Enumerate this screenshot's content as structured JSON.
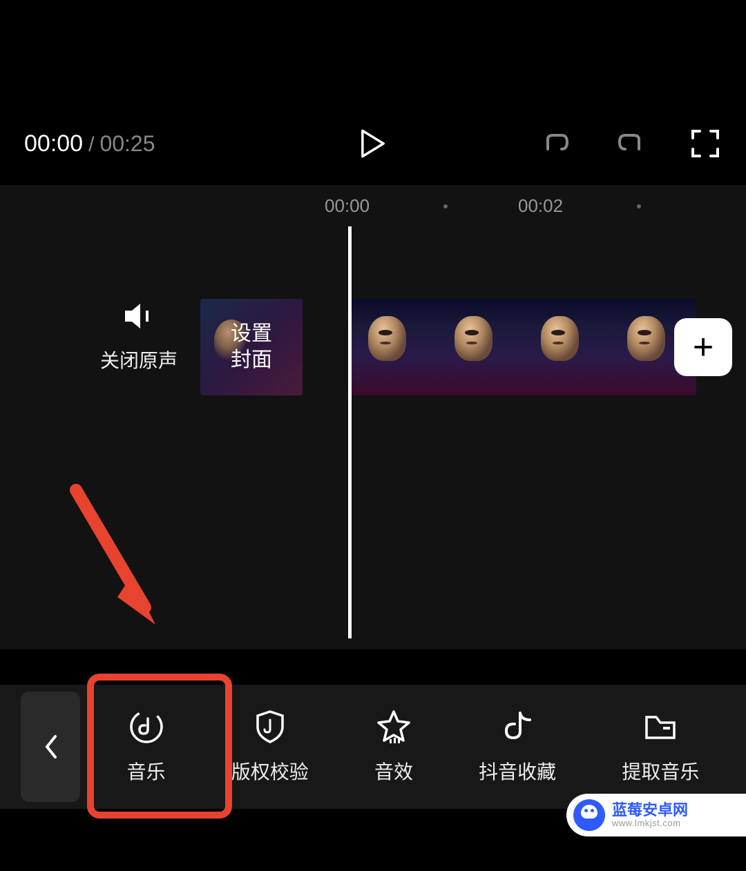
{
  "player": {
    "current_time": "00:00",
    "separator": "/",
    "total_time": "00:25"
  },
  "ruler": {
    "marks": [
      "00:00",
      "00:02"
    ]
  },
  "track": {
    "mute_label": "关闭原声",
    "cover_label_line1": "设置",
    "cover_label_line2": "封面"
  },
  "toolbar": {
    "items": [
      {
        "label": "音乐"
      },
      {
        "label": "版权校验"
      },
      {
        "label": "音效"
      },
      {
        "label": "抖音收藏"
      },
      {
        "label": "提取音乐"
      }
    ]
  },
  "watermark": {
    "title": "蓝莓安卓网",
    "url": "www.lmkjst.com"
  }
}
